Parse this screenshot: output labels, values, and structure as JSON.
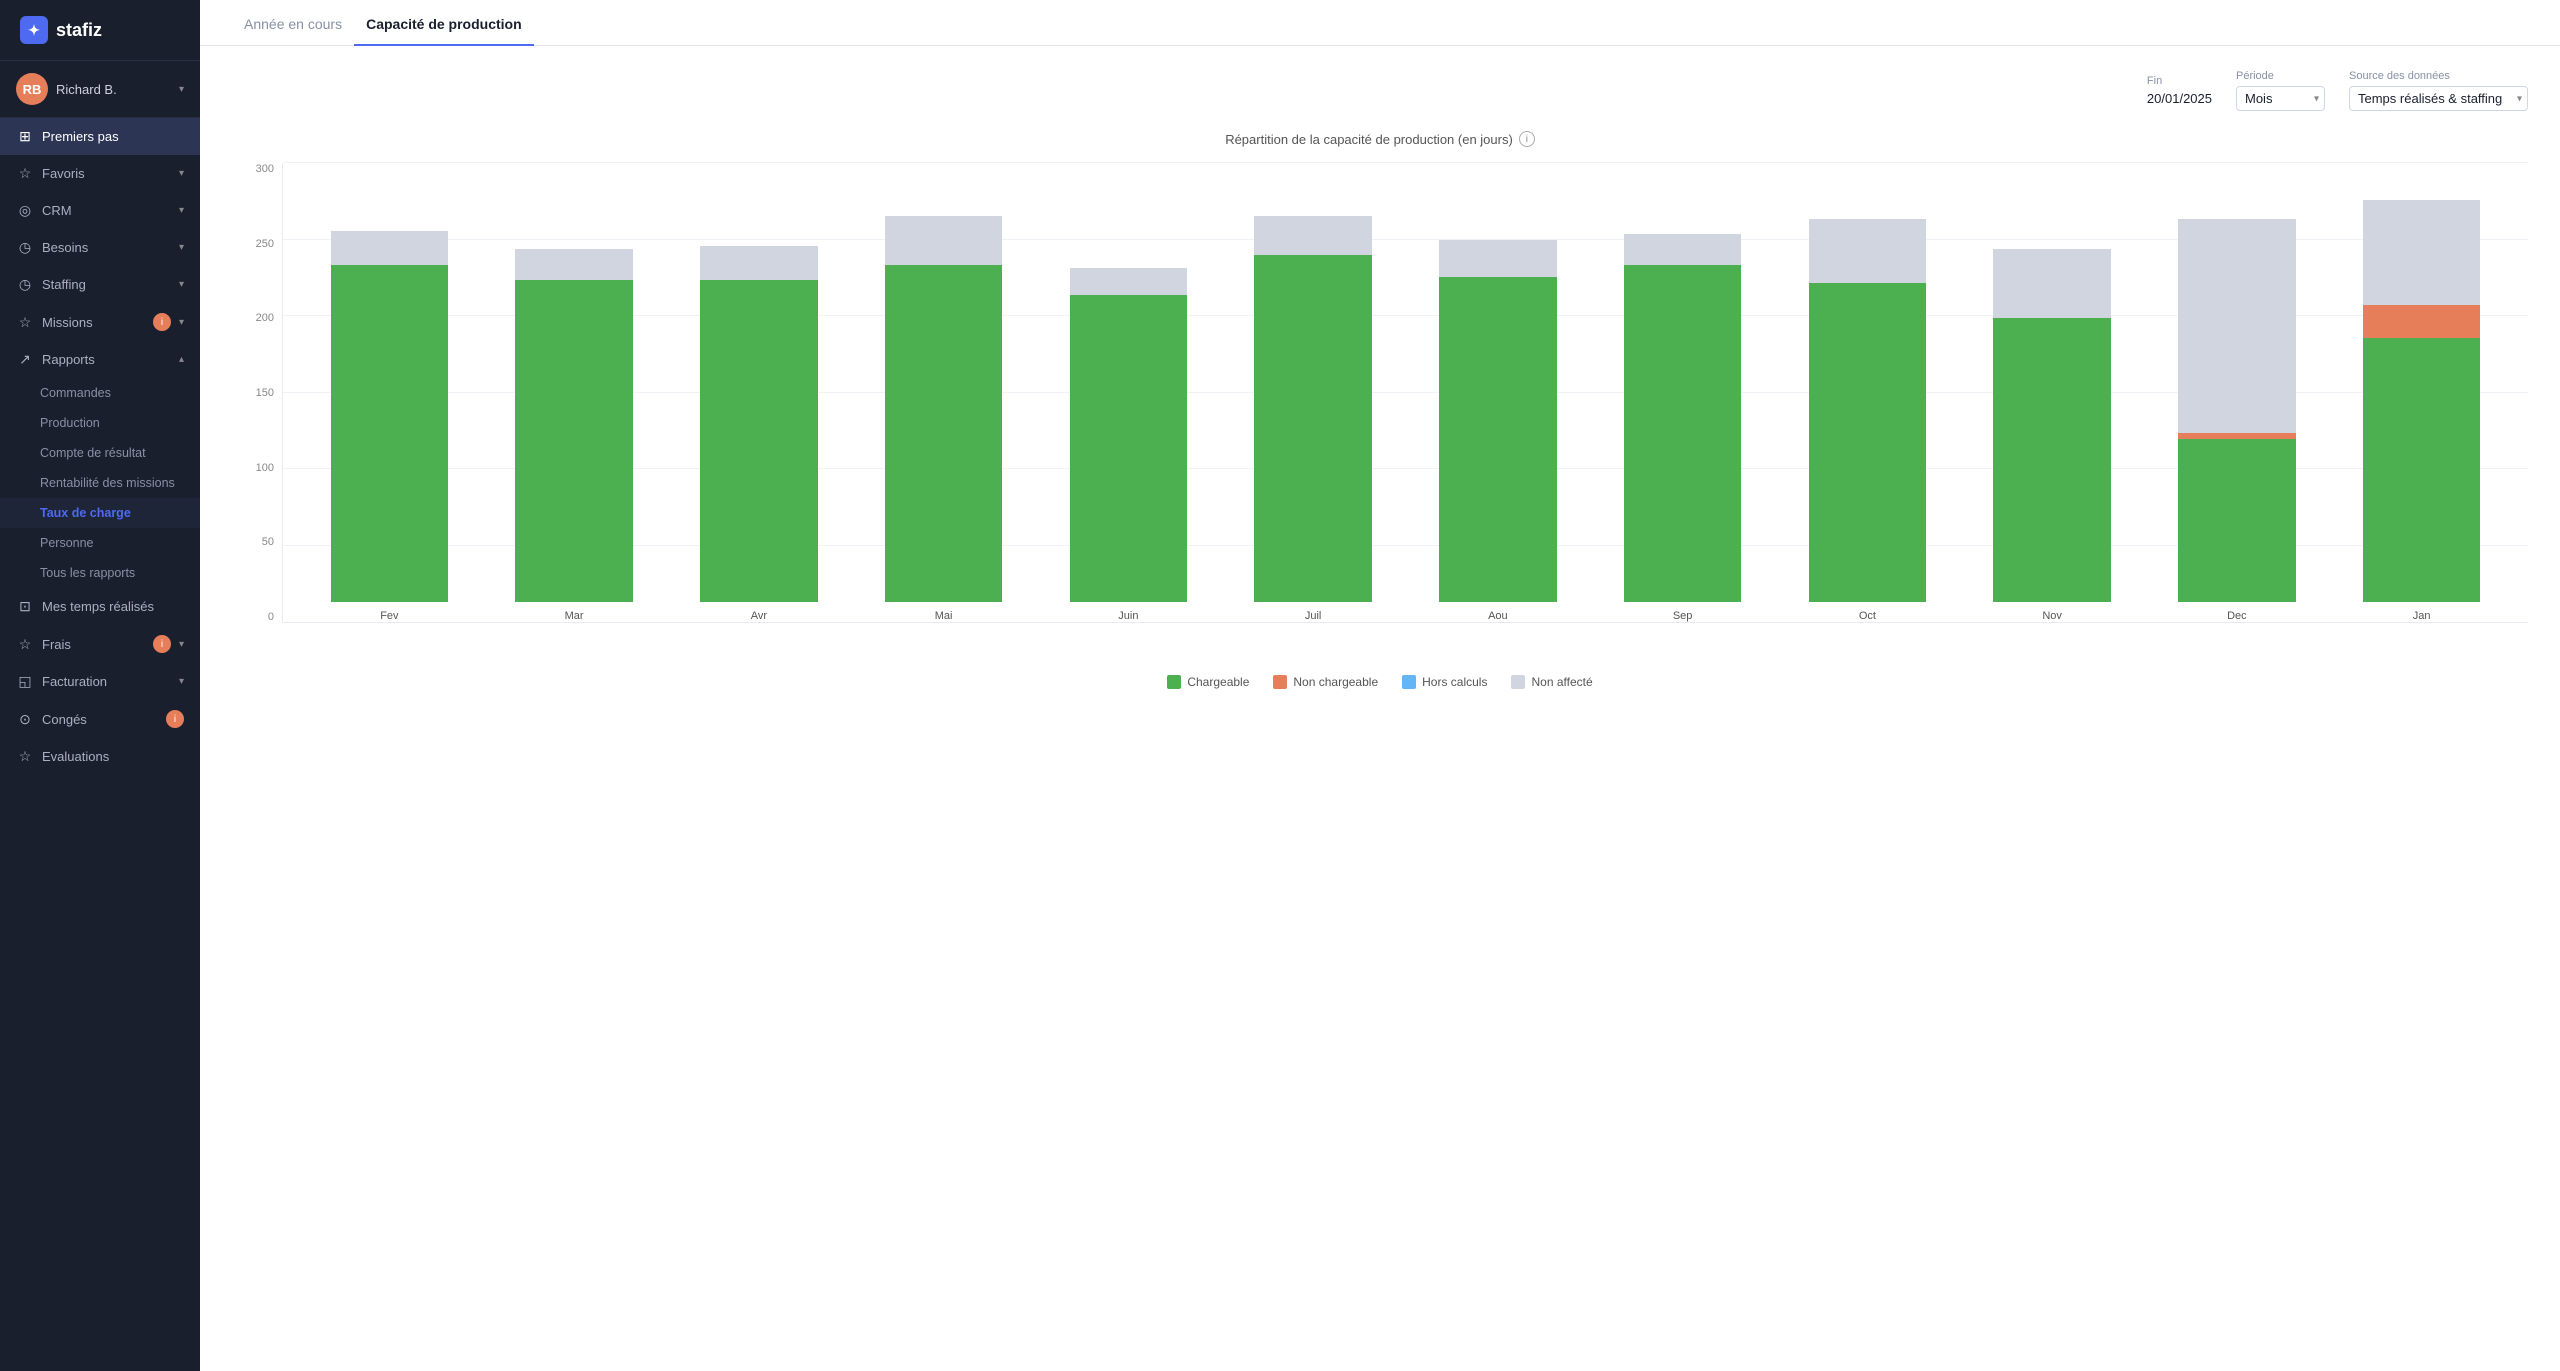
{
  "app": {
    "logo": "stafiz",
    "logo_icon": "S"
  },
  "user": {
    "name": "Richard B.",
    "initials": "RB"
  },
  "sidebar": {
    "items": [
      {
        "id": "premiers-pas",
        "label": "Premiers pas",
        "icon": "⊞",
        "active": true,
        "type": "item"
      },
      {
        "id": "favoris",
        "label": "Favoris",
        "icon": "☆",
        "has_arrow": true,
        "type": "item"
      },
      {
        "id": "crm",
        "label": "CRM",
        "icon": "◎",
        "has_arrow": true,
        "type": "item"
      },
      {
        "id": "besoins",
        "label": "Besoins",
        "icon": "◷",
        "has_arrow": true,
        "type": "item"
      },
      {
        "id": "staffing",
        "label": "Staffing",
        "icon": "◷",
        "has_arrow": true,
        "type": "item"
      },
      {
        "id": "missions",
        "label": "Missions",
        "icon": "☆",
        "has_badge": true,
        "has_arrow": true,
        "type": "item"
      },
      {
        "id": "rapports",
        "label": "Rapports",
        "icon": "↗",
        "has_arrow": true,
        "expanded": true,
        "type": "item"
      }
    ],
    "sub_items": [
      {
        "id": "commandes",
        "label": "Commandes"
      },
      {
        "id": "production",
        "label": "Production"
      },
      {
        "id": "compte-resultat",
        "label": "Compte de résultat"
      },
      {
        "id": "rentabilite",
        "label": "Rentabilité des missions"
      },
      {
        "id": "taux-charge",
        "label": "Taux de charge",
        "active": true
      },
      {
        "id": "personne",
        "label": "Personne"
      },
      {
        "id": "tous-rapports",
        "label": "Tous les rapports"
      }
    ],
    "bottom_items": [
      {
        "id": "mes-temps",
        "label": "Mes temps réalisés",
        "icon": "⊡"
      },
      {
        "id": "frais",
        "label": "Frais",
        "icon": "☆",
        "has_badge": true,
        "has_arrow": true
      },
      {
        "id": "facturation",
        "label": "Facturation",
        "icon": "◱",
        "has_arrow": true
      },
      {
        "id": "conges",
        "label": "Congés",
        "icon": "⊙",
        "has_badge": true
      },
      {
        "id": "evaluations",
        "label": "Evaluations",
        "icon": "☆"
      }
    ]
  },
  "tabs": [
    {
      "id": "annee",
      "label": "Année en cours",
      "active": false
    },
    {
      "id": "capacite",
      "label": "Capacité de production",
      "active": true
    }
  ],
  "controls": {
    "fin_label": "Fin",
    "fin_value": "20/01/2025",
    "periode_label": "Période",
    "periode_value": "Mois",
    "source_label": "Source des données",
    "source_value": "Temps réalisés & staffing"
  },
  "chart": {
    "title": "Répartition de la capacité de production (en jours)",
    "y_labels": [
      "300",
      "250",
      "200",
      "150",
      "100",
      "50",
      "0"
    ],
    "max_value": 300,
    "colors": {
      "chargeable": "#4caf50",
      "non_chargeable": "#e67e5a",
      "hors_calculs": "#64b5f6",
      "non_affecte": "#d0d5e0"
    },
    "legend": [
      {
        "id": "chargeable",
        "label": "Chargeable",
        "color": "#4caf50"
      },
      {
        "id": "non-chargeable",
        "label": "Non chargeable",
        "color": "#e67e5a"
      },
      {
        "id": "hors-calculs",
        "label": "Hors calculs",
        "color": "#64b5f6"
      },
      {
        "id": "non-affecte",
        "label": "Non affecté",
        "color": "#d0d5e0"
      }
    ],
    "bars": [
      {
        "month": "Fev",
        "chargeable": 220,
        "non_chargeable": 0,
        "hors_calculs": 0,
        "non_affecte": 22
      },
      {
        "month": "Mar",
        "chargeable": 210,
        "non_chargeable": 0,
        "hors_calculs": 0,
        "non_affecte": 20
      },
      {
        "month": "Avr",
        "chargeable": 210,
        "non_chargeable": 0,
        "hors_calculs": 0,
        "non_affecte": 22
      },
      {
        "month": "Mai",
        "chargeable": 220,
        "non_chargeable": 0,
        "hors_calculs": 0,
        "non_affecte": 32
      },
      {
        "month": "Juin",
        "chargeable": 200,
        "non_chargeable": 0,
        "hors_calculs": 0,
        "non_affecte": 18
      },
      {
        "month": "Juil",
        "chargeable": 226,
        "non_chargeable": 0,
        "hors_calculs": 0,
        "non_affecte": 26
      },
      {
        "month": "Aou",
        "chargeable": 212,
        "non_chargeable": 0,
        "hors_calculs": 0,
        "non_affecte": 24
      },
      {
        "month": "Sep",
        "chargeable": 220,
        "non_chargeable": 0,
        "hors_calculs": 0,
        "non_affecte": 20
      },
      {
        "month": "Oct",
        "chargeable": 208,
        "non_chargeable": 0,
        "hors_calculs": 0,
        "non_affecte": 42
      },
      {
        "month": "Nov",
        "chargeable": 185,
        "non_chargeable": 0,
        "hors_calculs": 0,
        "non_affecte": 45
      },
      {
        "month": "Dec",
        "chargeable": 106,
        "non_chargeable": 4,
        "hors_calculs": 0,
        "non_affecte": 140
      },
      {
        "month": "Jan",
        "chargeable": 172,
        "non_chargeable": 22,
        "hors_calculs": 0,
        "non_affecte": 68
      }
    ]
  }
}
